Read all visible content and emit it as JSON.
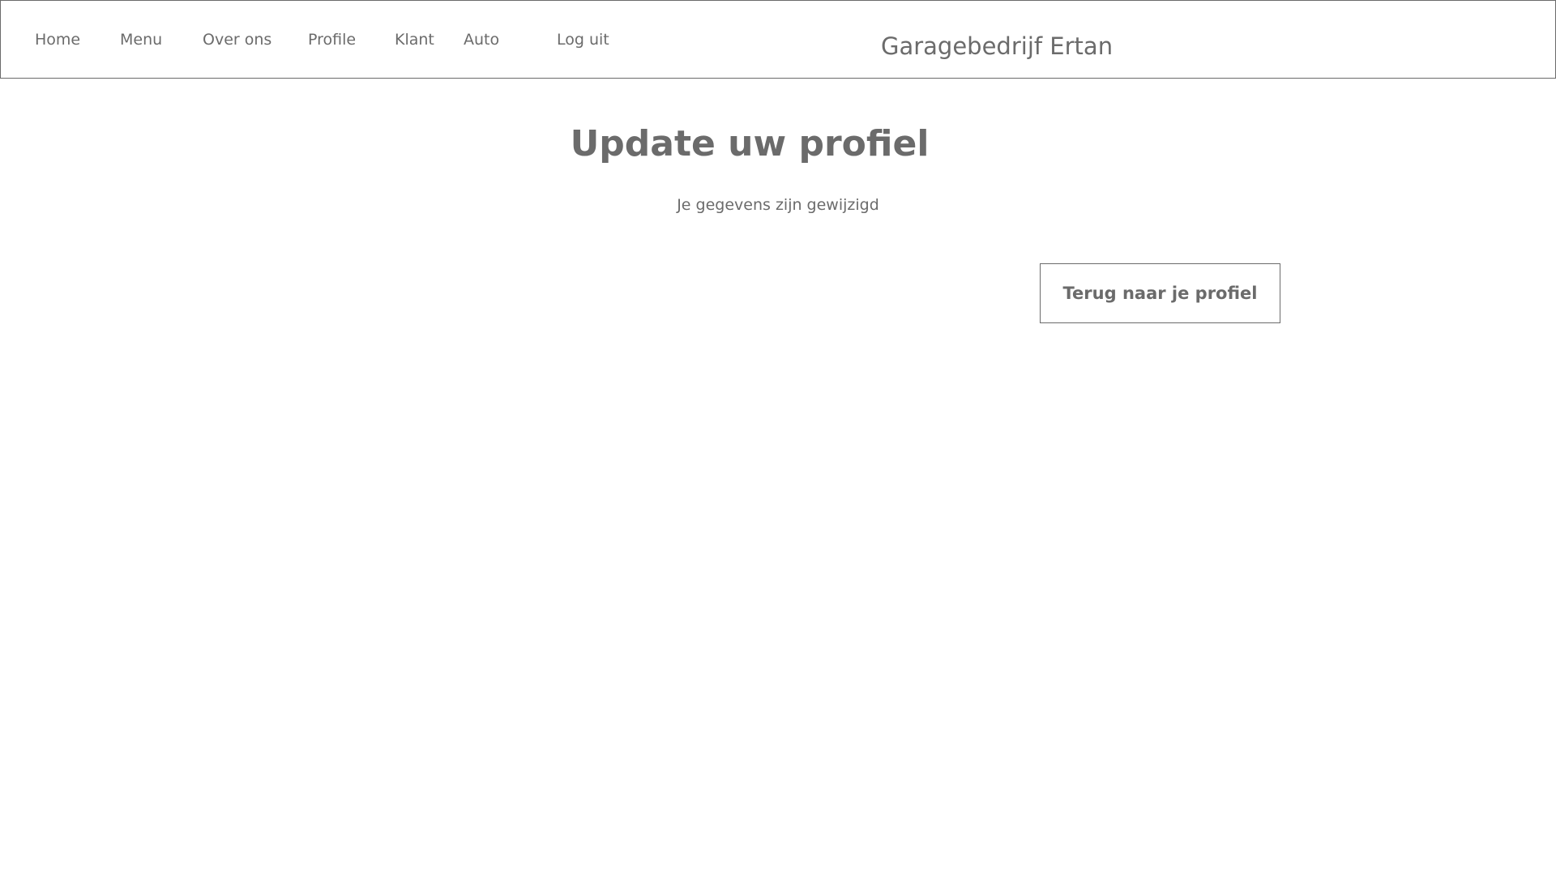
{
  "header": {
    "nav_items": [
      "Home",
      "Menu",
      "Over ons",
      "Profile",
      "Klant",
      "Auto",
      "Log uit"
    ],
    "brand": "Garagebedrijf Ertan"
  },
  "main": {
    "title": "Update uw profiel",
    "message": "Je gegevens zijn gewijzigd",
    "back_button_label": "Terug naar je profiel"
  },
  "colors": {
    "text": "#6b6b6b",
    "border": "#6b6b6b",
    "background": "#ffffff"
  }
}
